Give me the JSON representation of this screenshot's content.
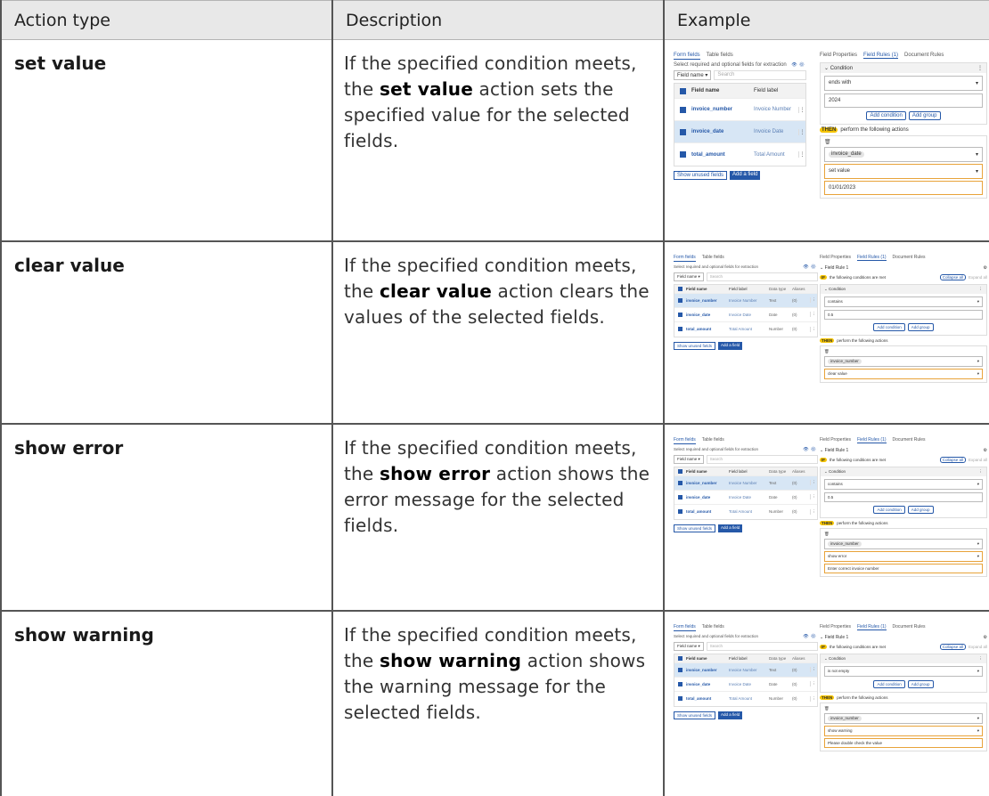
{
  "headers": {
    "action_type": "Action type",
    "description": "Description",
    "example": "Example"
  },
  "rows": [
    {
      "action": "set value",
      "desc_pre": "If the specified condition meets, the ",
      "desc_bold": "set value",
      "desc_post": " action sets the specified value for the selected fields.",
      "example": {
        "tabs": [
          "Form fields",
          "Table fields"
        ],
        "subtitle": "Select required and optional fields for extraction",
        "filter_select": "Field name",
        "search_placeholder": "Search",
        "col_field_name": "Field name",
        "col_field_label": "Field label",
        "col_data_type": "",
        "col_aliases": "",
        "fields": [
          {
            "name": "invoice_number",
            "label": "Invoice Number",
            "type": "",
            "alias": ""
          },
          {
            "name": "invoice_date",
            "label": "Invoice Date",
            "type": "",
            "alias": ""
          },
          {
            "name": "total_amount",
            "label": "Total Amount",
            "type": "",
            "alias": ""
          }
        ],
        "show_unused": "Show unused fields",
        "add_field": "Add a field",
        "rtabs": [
          "Field Properties",
          "Field Rules (1)",
          "Document Rules"
        ],
        "rule_title": "",
        "if_text": "",
        "if_label": "",
        "collapse_all": "",
        "expand_all": "",
        "condition": "Condition",
        "operator": "ends with",
        "cond_value": "2024",
        "add_condition": "Add condition",
        "add_group": "Add group",
        "then_label": "THEN",
        "then_text": "perform the following actions",
        "target_field": "invoice_date",
        "action_value": "set value",
        "extra_value": "01/01/2023"
      }
    },
    {
      "action": "clear value",
      "desc_pre": "If the specified condition meets, the ",
      "desc_bold": "clear value",
      "desc_post": " action clears the values of the selected fields.",
      "example": {
        "tabs": [
          "Form fields",
          "Table fields"
        ],
        "subtitle": "Select required and optional fields for extraction",
        "filter_select": "Field name",
        "search_placeholder": "Search",
        "col_field_name": "Field name",
        "col_field_label": "Field label",
        "col_data_type": "Data type",
        "col_aliases": "Aliases",
        "fields": [
          {
            "name": "invoice_number",
            "label": "Invoice Number",
            "type": "Text",
            "alias": "(0)"
          },
          {
            "name": "invoice_date",
            "label": "Invoice Date",
            "type": "Date",
            "alias": "(0)"
          },
          {
            "name": "total_amount",
            "label": "Total Amount",
            "type": "Number",
            "alias": "(0)"
          }
        ],
        "show_unused": "Show unused fields",
        "add_field": "Add a field",
        "rtabs": [
          "Field Properties",
          "Field Rules (1)",
          "Document Rules"
        ],
        "rule_title": "Field Rule 1",
        "if_label": "IF",
        "if_text": "the following conditions are met",
        "collapse_all": "Collapse all",
        "expand_all": "Expand all",
        "condition": "Condition",
        "operator": "contains",
        "cond_value": "0.5",
        "add_condition": "Add condition",
        "add_group": "Add group",
        "then_label": "THEN",
        "then_text": "perform the following actions",
        "target_field": "invoice_number",
        "action_value": "clear value",
        "extra_value": ""
      }
    },
    {
      "action": "show error",
      "desc_pre": "If the specified condition meets, the ",
      "desc_bold": "show error",
      "desc_post": " action shows the error message for the selected fields.",
      "example": {
        "tabs": [
          "Form fields",
          "Table fields"
        ],
        "subtitle": "Select required and optional fields for extraction",
        "filter_select": "Field name",
        "search_placeholder": "Search",
        "col_field_name": "Field name",
        "col_field_label": "Field label",
        "col_data_type": "Data type",
        "col_aliases": "Aliases",
        "fields": [
          {
            "name": "invoice_number",
            "label": "Invoice Number",
            "type": "Text",
            "alias": "(0)"
          },
          {
            "name": "invoice_date",
            "label": "Invoice Date",
            "type": "Date",
            "alias": "(0)"
          },
          {
            "name": "total_amount",
            "label": "Total Amount",
            "type": "Number",
            "alias": "(0)"
          }
        ],
        "show_unused": "Show unused fields",
        "add_field": "Add a field",
        "rtabs": [
          "Field Properties",
          "Field Rules (1)",
          "Document Rules"
        ],
        "rule_title": "Field Rule 1",
        "if_label": "IF",
        "if_text": "the following conditions are met",
        "collapse_all": "Collapse all",
        "expand_all": "Expand all",
        "condition": "Condition",
        "operator": "contains",
        "cond_value": "0.5",
        "add_condition": "Add condition",
        "add_group": "Add group",
        "then_label": "THEN",
        "then_text": "perform the following actions",
        "target_field": "invoice_number",
        "action_value": "show error",
        "extra_value": "Enter correct invoice number"
      }
    },
    {
      "action": "show warning",
      "desc_pre": "If the specified condition meets, the ",
      "desc_bold": "show warning",
      "desc_post": " action shows the warning message for the selected fields.",
      "example": {
        "tabs": [
          "Form fields",
          "Table fields"
        ],
        "subtitle": "Select required and optional fields for extraction",
        "filter_select": "Field name",
        "search_placeholder": "Search",
        "col_field_name": "Field name",
        "col_field_label": "Field label",
        "col_data_type": "Data type",
        "col_aliases": "Aliases",
        "fields": [
          {
            "name": "invoice_number",
            "label": "Invoice Number",
            "type": "Text",
            "alias": "(0)"
          },
          {
            "name": "invoice_date",
            "label": "Invoice Date",
            "type": "Date",
            "alias": "(0)"
          },
          {
            "name": "total_amount",
            "label": "Total Amount",
            "type": "Number",
            "alias": "(0)"
          }
        ],
        "show_unused": "Show unused fields",
        "add_field": "Add a field",
        "rtabs": [
          "Field Properties",
          "Field Rules (1)",
          "Document Rules"
        ],
        "rule_title": "Field Rule 1",
        "if_label": "IF",
        "if_text": "the following conditions are met",
        "collapse_all": "Collapse all",
        "expand_all": "Expand all",
        "condition": "Condition",
        "operator": "is not empty",
        "cond_value": "",
        "add_condition": "Add condition",
        "add_group": "Add group",
        "then_label": "THEN",
        "then_text": "perform the following actions",
        "target_field": "invoice_number",
        "action_value": "show warning",
        "extra_value": "Please double check the value"
      }
    }
  ]
}
